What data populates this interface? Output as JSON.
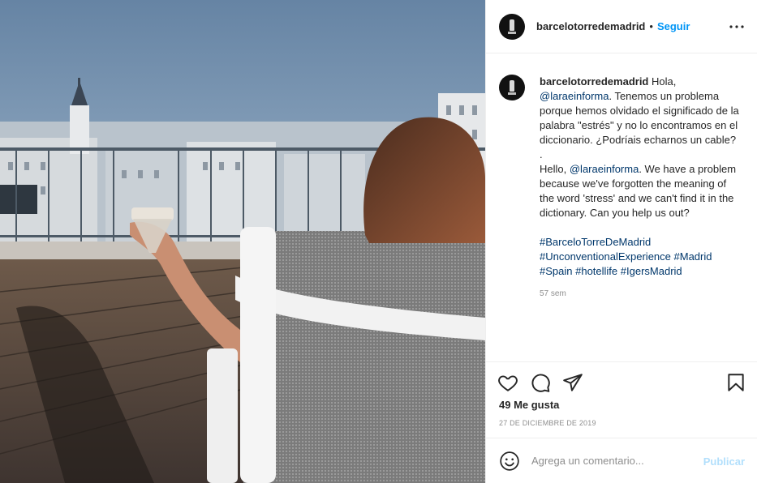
{
  "photo": {
    "alt": ""
  },
  "header": {
    "username": "barcelotorredemadrid",
    "separator": "•",
    "follow_label": "Seguir",
    "more_icon": "more-horizontal-icon"
  },
  "caption": {
    "username": "barcelotorredemadrid",
    "text_es_1": " Hola, ",
    "mention_1": "@laraeinforma",
    "text_es_2": ". Tenemos un problema porque hemos olvidado el significado de la palabra \"estrés\" y no lo encontramos en el diccionario. ¿Podríais echarnos un cable?",
    "dot_line": ".",
    "text_en_1": "Hello, ",
    "mention_2": "@laraeinforma",
    "text_en_2": ". We have a problem because we've forgotten the meaning of the word 'stress' and we can't find it in the dictionary. Can you help us out?",
    "hashtags": [
      "#BarceloTorreDeMadrid",
      "#UnconventionalExperience",
      "#Madrid",
      "#Spain",
      "#hotellife",
      "#IgersMadrid"
    ],
    "time": "57 sem"
  },
  "actions": {
    "like_icon": "heart-icon",
    "comment_icon": "comment-icon",
    "share_icon": "share-icon",
    "save_icon": "bookmark-icon"
  },
  "likes": "49 Me gusta",
  "date": "27 DE DICIEMBRE DE 2019",
  "comment": {
    "placeholder": "Agrega un comentario...",
    "publish_label": "Publicar",
    "emoji_icon": "emoji-icon"
  },
  "colors": {
    "accent": "#0095f6",
    "publish_disabled": "#b2dffc",
    "link": "#00376b",
    "muted": "#8e8e8e",
    "text": "#262626"
  }
}
